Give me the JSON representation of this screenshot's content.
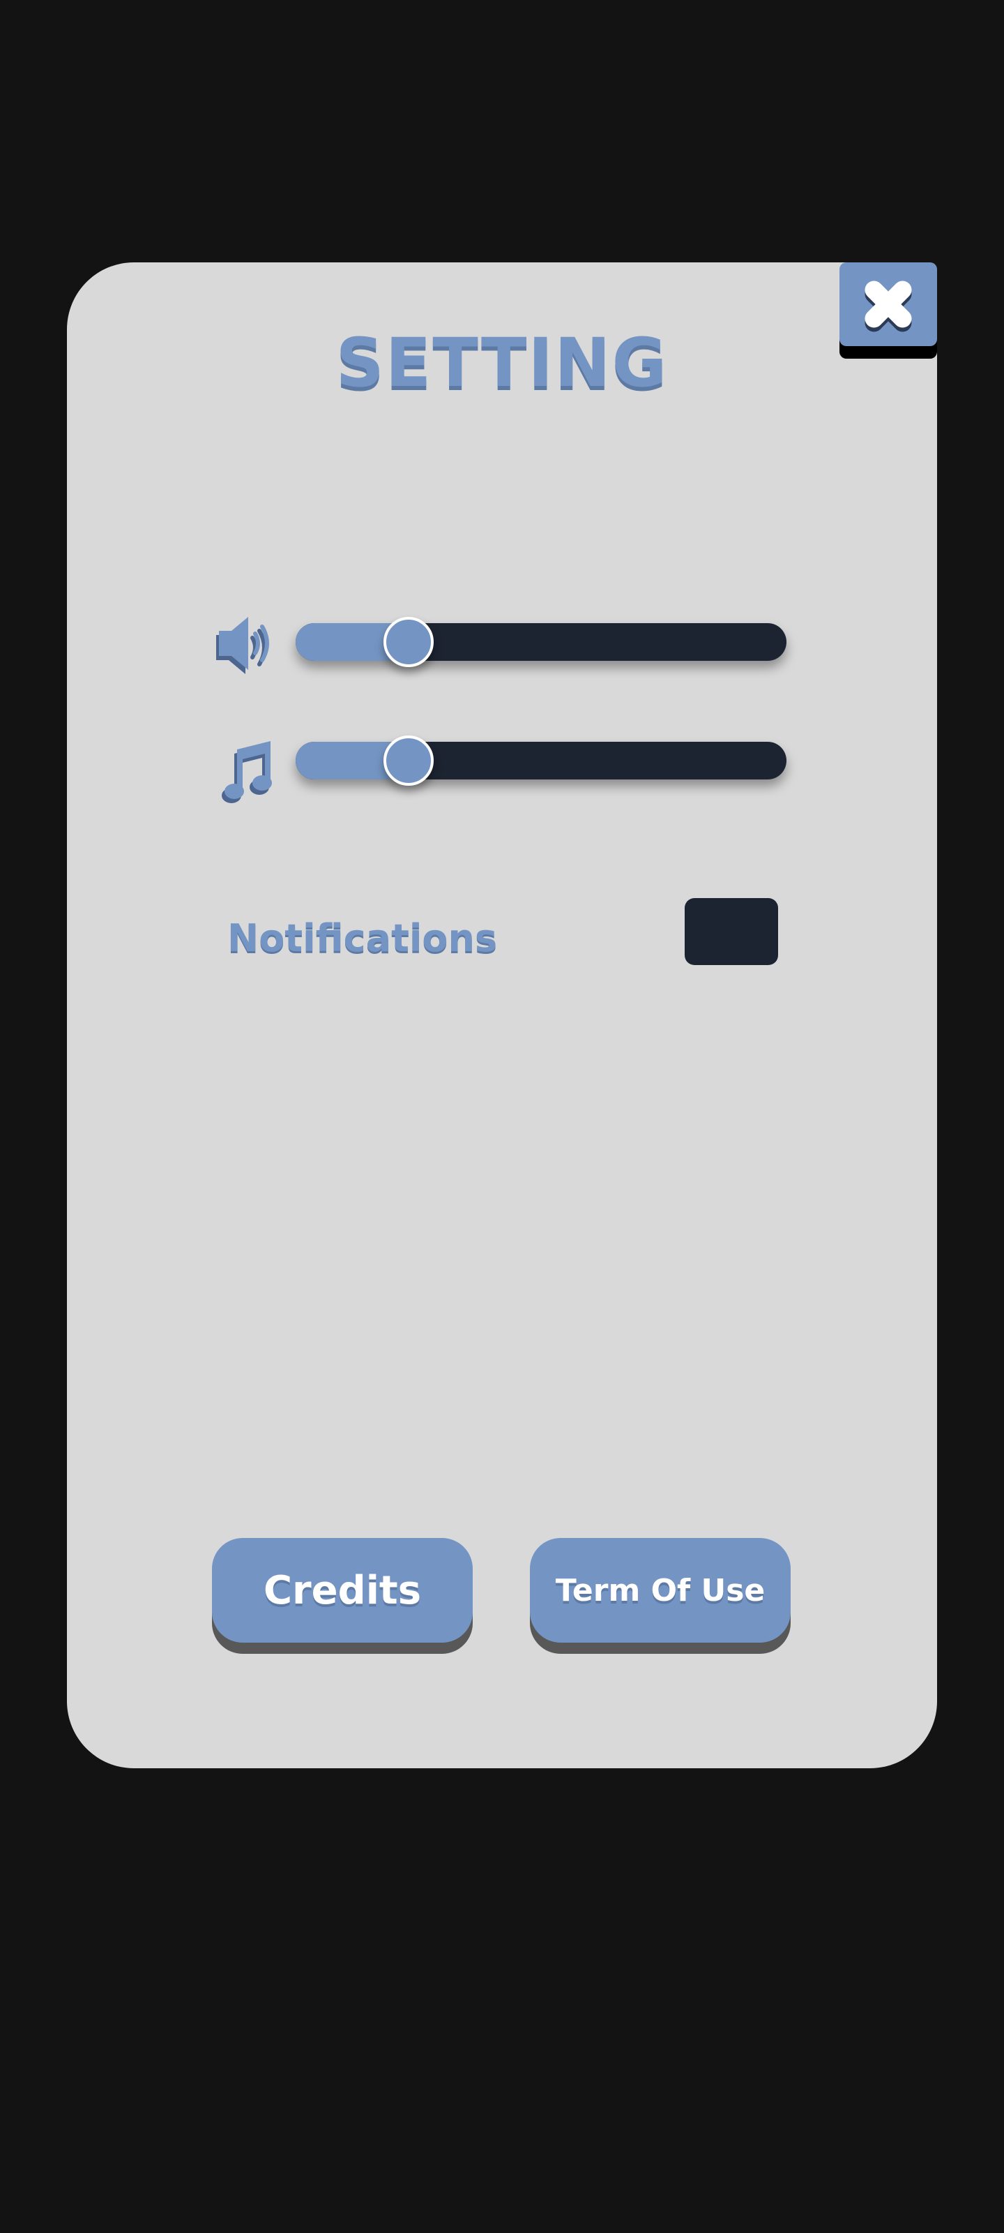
{
  "dialog": {
    "title": "SETTING",
    "close_icon": "close-x-icon"
  },
  "sound": {
    "icon": "speaker-volume-icon",
    "level": 0.23
  },
  "music": {
    "icon": "music-note-icon",
    "level": 0.23
  },
  "notifications": {
    "label": "Notifications",
    "toggle_state": "off"
  },
  "buttons": {
    "credits_label": "Credits",
    "terms_label": "Term Of Use"
  },
  "colors": {
    "background": "#131313",
    "panel": "#d9d9d9",
    "accent": "#7495c3",
    "accent_shadow": "#5d7aa4",
    "track": "#1d2431"
  }
}
